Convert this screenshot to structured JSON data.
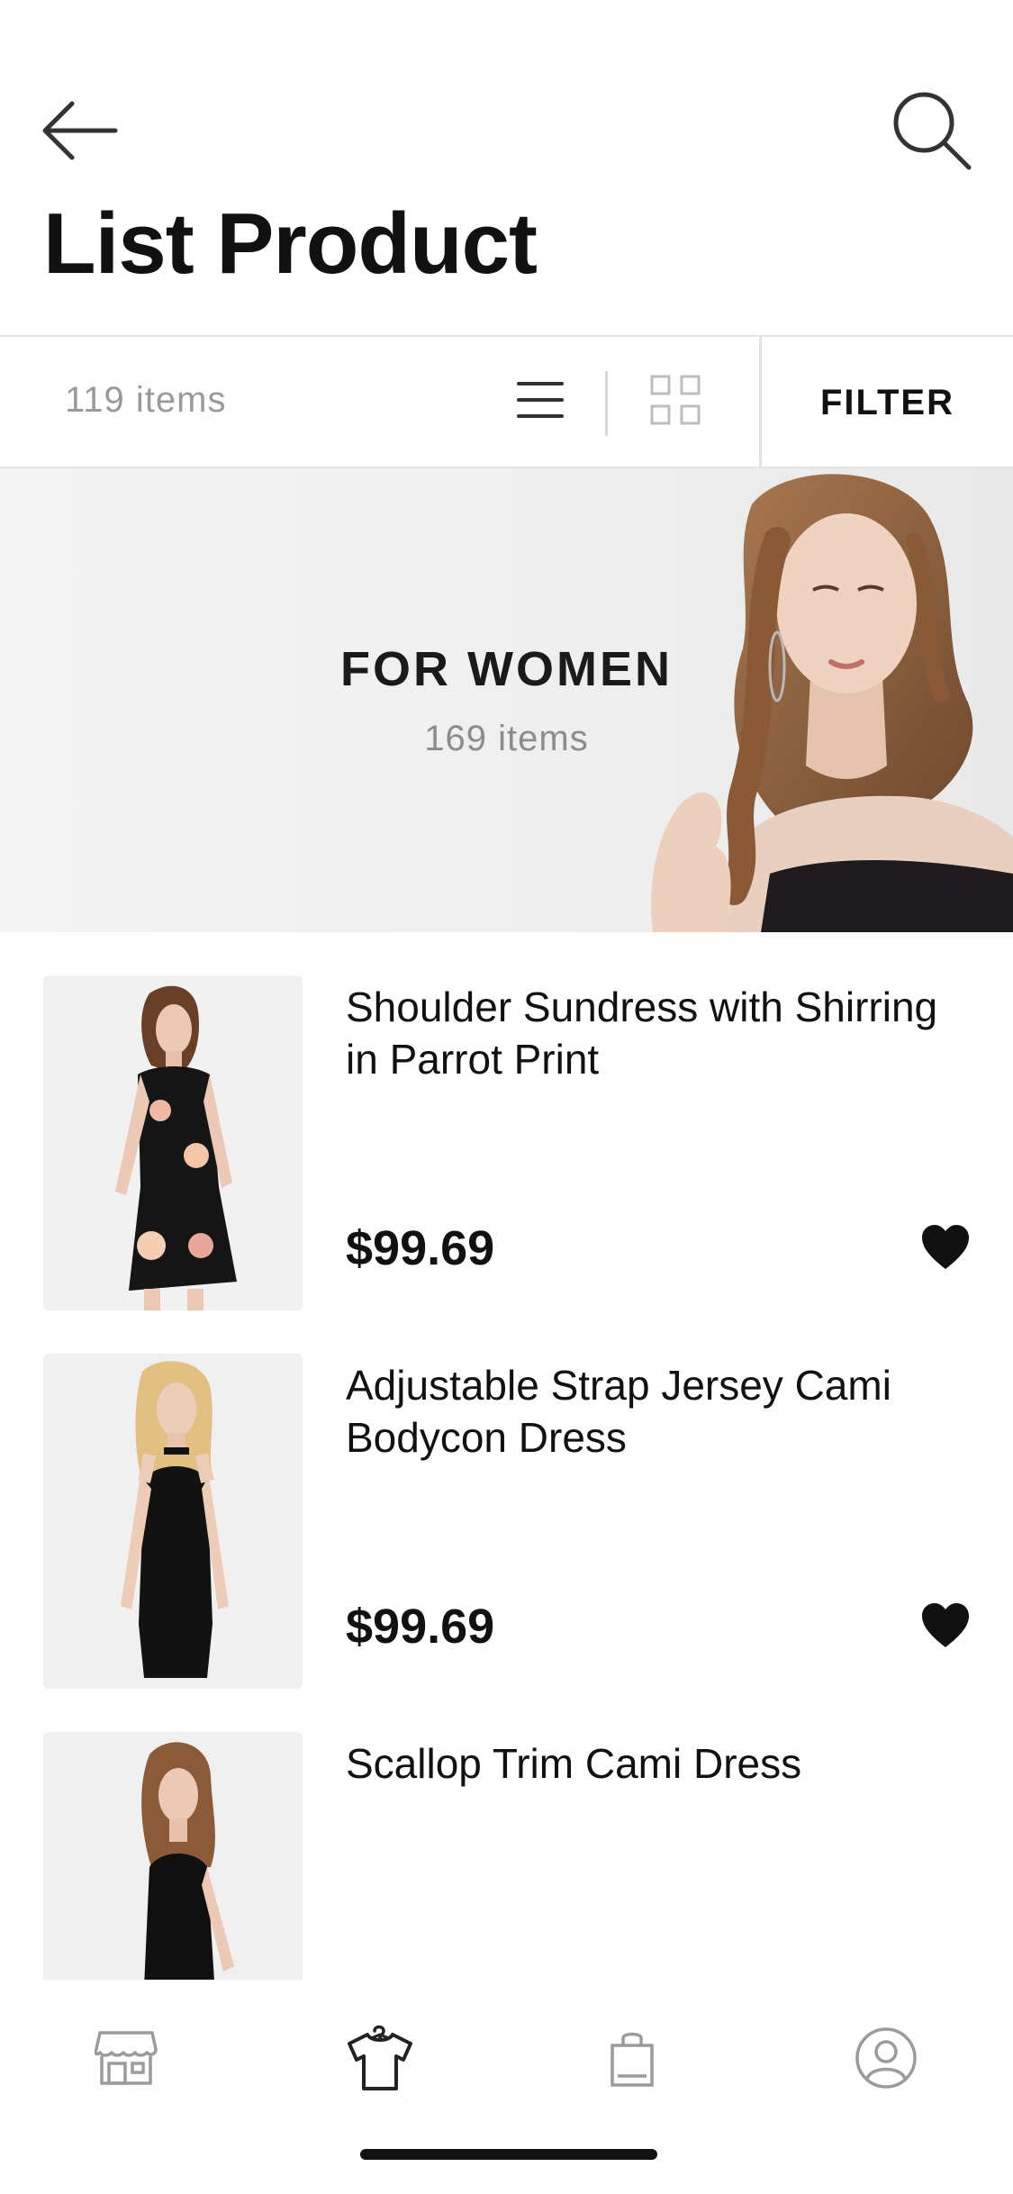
{
  "header": {
    "title": "List Product",
    "back_icon": "arrow-left-icon",
    "search_icon": "search-icon"
  },
  "toolbar": {
    "item_count": "119 items",
    "list_view_icon": "list-view-icon",
    "grid_view_icon": "grid-view-icon",
    "active_view": "list",
    "filter_label": "FILTER"
  },
  "banner": {
    "title": "FOR WOMEN",
    "count": "169 items"
  },
  "products": [
    {
      "name": "Shoulder Sundress with Shirring in Parrot Print",
      "price": "$99.69",
      "favorite": true
    },
    {
      "name": "Adjustable Strap Jersey Cami Bodycon Dress",
      "price": "$99.69",
      "favorite": true
    },
    {
      "name": "Scallop Trim Cami Dress",
      "price": "",
      "favorite": false
    }
  ],
  "tab_bar": {
    "tabs": [
      {
        "icon": "store-icon",
        "active": false
      },
      {
        "icon": "shirt-icon",
        "active": true
      },
      {
        "icon": "shopping-bag-icon",
        "active": false
      },
      {
        "icon": "user-profile-icon",
        "active": false
      }
    ]
  },
  "colors": {
    "text_primary": "#111111",
    "text_muted": "#9a9a9a",
    "divider": "#e3e3e3",
    "icon_inactive": "#9b9b9b",
    "banner_bg": "#f2f2f2"
  }
}
